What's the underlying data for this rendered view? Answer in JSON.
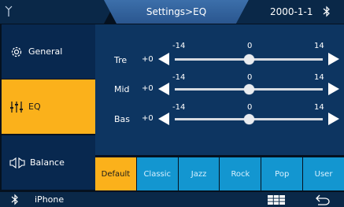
{
  "status_bar": {
    "title": "Settings>EQ",
    "date": "2000-1-1",
    "bluetooth_icon": "bluetooth-icon",
    "antenna_icon": "antenna-icon"
  },
  "sidebar": {
    "items": [
      {
        "label": "General",
        "icon": "gear-icon",
        "active": false
      },
      {
        "label": "EQ",
        "icon": "equalizer-icon",
        "active": true
      },
      {
        "label": "Balance",
        "icon": "speaker-balance-icon",
        "active": false
      }
    ]
  },
  "eq": {
    "bands": [
      {
        "name": "Tre",
        "value": "+0",
        "min": "-14",
        "mid": "0",
        "max": "14",
        "level": 0
      },
      {
        "name": "Mid",
        "value": "+0",
        "min": "-14",
        "mid": "0",
        "max": "14",
        "level": 0
      },
      {
        "name": "Bas",
        "value": "+0",
        "min": "-14",
        "mid": "0",
        "max": "14",
        "level": 0
      }
    ]
  },
  "presets": {
    "items": [
      "Default",
      "Classic",
      "Jazz",
      "Rock",
      "Pop",
      "User"
    ],
    "selected": "Default"
  },
  "bottom_bar": {
    "device_name": "iPhone",
    "bluetooth_icon": "bluetooth-icon",
    "keypad_icon": "keypad-icon",
    "back_icon": "back-icon"
  },
  "colors": {
    "accent": "#fbb11b",
    "panel": "#0d3561",
    "preset_button": "#1396d0"
  }
}
